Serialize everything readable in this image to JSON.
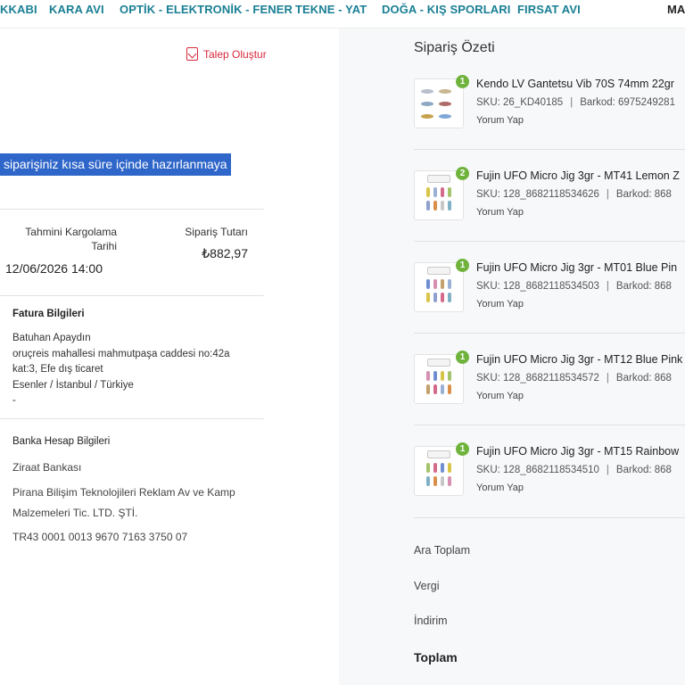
{
  "nav": {
    "items": [
      "KKABI",
      "KARA AVI",
      "OPTİK - ELEKTRONİK - FENER",
      "TEKNE - YAT",
      "DOĞA - KIŞ SPORLARI",
      "FIRSAT AVI",
      "MA"
    ]
  },
  "order": {
    "request_label": "Talep Oluştur",
    "status_message": "siparişiniz kısa süre içinde hazırlanmaya",
    "ship_label": "Tahmini Kargolama Tarihi",
    "ship_label_line1": "Tahmini Kargolama",
    "ship_label_line2": "Tarihi",
    "ship_date": "12/06/2026 14:00",
    "amount_label": "Sipariş Tutarı",
    "amount": "₺882,97"
  },
  "invoice": {
    "title": "Fatura Bilgileri",
    "name": "Batuhan Apaydın",
    "address_line1": "oruçreis mahallesi mahmutpaşa caddesi no:42a",
    "address_line2": "kat:3, Efe dış ticaret",
    "address_line3": "Esenler / İstanbul / Türkiye",
    "address_line4": "-"
  },
  "bank": {
    "title": "Banka Hesap Bilgileri",
    "bank_name": "Ziraat Bankası",
    "company_line1": "Pirana Bilişim Teknolojileri Reklam Av ve Kamp",
    "company_line2": "Malzemeleri Tic. LTD. ŞTİ.",
    "iban": "TR43 0001 0013 9670 7163 3750 07"
  },
  "summary": {
    "title": "Sipariş Özeti",
    "review_label": "Yorum Yap",
    "items": [
      {
        "qty": "1",
        "name": "Kendo LV Gantetsu Vib 70S 74mm 22gr",
        "sku": "SKU: 26_KD40185",
        "barcode": "Barkod: 6975249281"
      },
      {
        "qty": "2",
        "name": "Fujin UFO Micro Jig 3gr - MT41 Lemon Z",
        "sku": "SKU: 128_8682118534626",
        "barcode": "Barkod: 868"
      },
      {
        "qty": "1",
        "name": "Fujin UFO Micro Jig 3gr - MT01 Blue Pin",
        "sku": "SKU: 128_8682118534503",
        "barcode": "Barkod: 868"
      },
      {
        "qty": "1",
        "name": "Fujin UFO Micro Jig 3gr - MT12 Blue Pink",
        "sku": "SKU: 128_8682118534572",
        "barcode": "Barkod: 868"
      },
      {
        "qty": "1",
        "name": "Fujin UFO Micro Jig 3gr - MT15 Rainbow",
        "sku": "SKU: 128_8682118534510",
        "barcode": "Barkod: 868"
      }
    ],
    "subtotal_label": "Ara Toplam",
    "tax_label": "Vergi",
    "discount_label": "İndirim",
    "total_label": "Toplam"
  },
  "colors": {
    "nav": "#1a7f94",
    "accent_red": "#d7283c",
    "highlight": "#2f66c9",
    "qty_badge": "#6fb33c"
  }
}
